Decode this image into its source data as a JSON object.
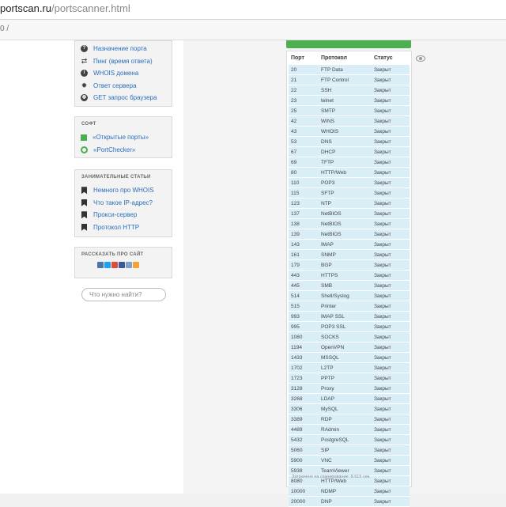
{
  "browser": {
    "url_host": "portscan.ru",
    "url_path": "/portscanner.html",
    "bookmark_fragment": "0 /"
  },
  "nav_links": [
    {
      "icon": "question-icon",
      "label": "Назначение порта"
    },
    {
      "icon": "arrows-icon",
      "label": "Пинг (время ответа)"
    },
    {
      "icon": "info-icon",
      "label": "WHOIS домена"
    },
    {
      "icon": "gear-icon",
      "label": "Ответ сервера"
    },
    {
      "icon": "globe-icon",
      "label": "GET запрос браузера"
    }
  ],
  "soft": {
    "title": "Софт",
    "items": [
      {
        "icon": "windows-icon",
        "label": "«Открытые порты»"
      },
      {
        "icon": "portchecker-icon",
        "label": "«PortChecker»"
      }
    ]
  },
  "articles": {
    "title": "Занимательные статьи",
    "items": [
      {
        "label": "Немного про WHOIS"
      },
      {
        "label": "Что такое IP-адрес?"
      },
      {
        "label": "Прокси-сервер"
      },
      {
        "label": "Протокол HTTP"
      }
    ]
  },
  "share": {
    "title": "Рассказать про сайт",
    "buttons": [
      {
        "name": "vk-icon",
        "color": "#4a76a8"
      },
      {
        "name": "twitter-icon",
        "color": "#1da1f2"
      },
      {
        "name": "google-plus-icon",
        "color": "#dd4b39"
      },
      {
        "name": "facebook-icon",
        "color": "#3b5998"
      },
      {
        "name": "livejournal-icon",
        "color": "#7ea0cc"
      },
      {
        "name": "odnoklassniki-icon",
        "color": "#f2a33a"
      }
    ]
  },
  "search": {
    "placeholder": "Что нужно найти?"
  },
  "table": {
    "headers": [
      "Порт",
      "Протокол",
      "Статус"
    ],
    "rows": [
      [
        "20",
        "FTP Data",
        "Закрыт"
      ],
      [
        "21",
        "FTP Control",
        "Закрыт"
      ],
      [
        "22",
        "SSH",
        "Закрыт"
      ],
      [
        "23",
        "telnet",
        "Закрыт"
      ],
      [
        "25",
        "SMTP",
        "Закрыт"
      ],
      [
        "42",
        "WINS",
        "Закрыт"
      ],
      [
        "43",
        "WHOIS",
        "Закрыт"
      ],
      [
        "53",
        "DNS",
        "Закрыт"
      ],
      [
        "67",
        "DHCP",
        "Закрыт"
      ],
      [
        "69",
        "TFTP",
        "Закрыт"
      ],
      [
        "80",
        "HTTP/Web",
        "Закрыт"
      ],
      [
        "110",
        "POP3",
        "Закрыт"
      ],
      [
        "115",
        "SFTP",
        "Закрыт"
      ],
      [
        "123",
        "NTP",
        "Закрыт"
      ],
      [
        "137",
        "NetBIOS",
        "Закрыт"
      ],
      [
        "138",
        "NetBIOS",
        "Закрыт"
      ],
      [
        "139",
        "NetBIOS",
        "Закрыт"
      ],
      [
        "143",
        "IMAP",
        "Закрыт"
      ],
      [
        "161",
        "SNMP",
        "Закрыт"
      ],
      [
        "179",
        "BGP",
        "Закрыт"
      ],
      [
        "443",
        "HTTPS",
        "Закрыт"
      ],
      [
        "445",
        "SMB",
        "Закрыт"
      ],
      [
        "514",
        "Shell/Syslog",
        "Закрыт"
      ],
      [
        "515",
        "Printer",
        "Закрыт"
      ],
      [
        "993",
        "IMAP SSL",
        "Закрыт"
      ],
      [
        "995",
        "POP3 SSL",
        "Закрыт"
      ],
      [
        "1080",
        "SOCKS",
        "Закрыт"
      ],
      [
        "1194",
        "OpenVPN",
        "Закрыт"
      ],
      [
        "1433",
        "MSSQL",
        "Закрыт"
      ],
      [
        "1702",
        "L2TP",
        "Закрыт"
      ],
      [
        "1723",
        "PPTP",
        "Закрыт"
      ],
      [
        "3128",
        "Proxy",
        "Закрыт"
      ],
      [
        "3268",
        "LDAP",
        "Закрыт"
      ],
      [
        "3306",
        "MySQL",
        "Закрыт"
      ],
      [
        "3389",
        "RDP",
        "Закрыт"
      ],
      [
        "4489",
        "RAdmin",
        "Закрыт"
      ],
      [
        "5432",
        "PostgreSQL",
        "Закрыт"
      ],
      [
        "5060",
        "SIP",
        "Закрыт"
      ],
      [
        "5900",
        "VNC",
        "Закрыт"
      ],
      [
        "5938",
        "TeamViewer",
        "Закрыт"
      ],
      [
        "8080",
        "HTTP/Web",
        "Закрыт"
      ],
      [
        "10000",
        "NDMP",
        "Закрыт"
      ],
      [
        "20000",
        "DNP",
        "Закрыт"
      ]
    ],
    "footer": "Затрачено на сканирование: 8.615 сек."
  },
  "colors": {
    "row_bg": "#daeef8",
    "link": "#2a6ebb",
    "accent": "#4caf50"
  }
}
